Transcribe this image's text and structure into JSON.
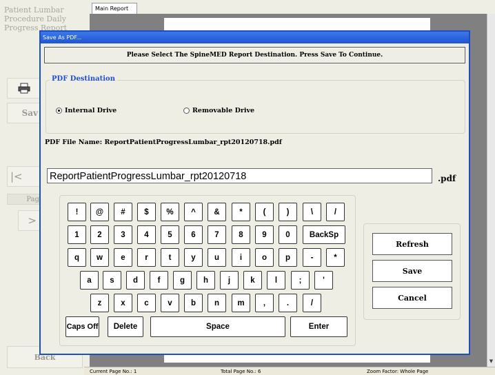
{
  "app": {
    "title": "Patient Lumbar Procedure Daily Progress Report",
    "save_label": "Sav",
    "first_label": "|<",
    "page_label": "Pag",
    "next_label": ">",
    "back_label": "Back"
  },
  "report": {
    "tab_label": "Main Report",
    "status": {
      "current_page": "Current Page No.: 1",
      "total_page": "Total Page No.: 6",
      "zoom": "Zoom Factor: Whole Page"
    }
  },
  "dialog": {
    "title": "Save As PDF...",
    "instruction": "Please Select The SpineMED Report Destination. Press Save To Continue.",
    "destination_legend": "PDF Destination",
    "options": [
      {
        "label": "Internal Drive",
        "selected": true
      },
      {
        "label": "Removable Drive",
        "selected": false
      }
    ],
    "filename_label": "PDF File Name: ReportPatientProgressLumbar_rpt20120718.pdf",
    "filename_value": "ReportPatientProgressLumbar_rpt20120718",
    "extension": ".pdf"
  },
  "keyboard": {
    "rows": [
      [
        "!",
        "@",
        "#",
        "$",
        "%",
        "^",
        "&",
        "*",
        "(",
        ")",
        "\\",
        "/"
      ],
      [
        "1",
        "2",
        "3",
        "4",
        "5",
        "6",
        "7",
        "8",
        "9",
        "0",
        "BackSp"
      ],
      [
        "q",
        "w",
        "e",
        "r",
        "t",
        "y",
        "u",
        "i",
        "o",
        "p",
        "-",
        "*"
      ],
      [
        "a",
        "s",
        "d",
        "f",
        "g",
        "h",
        "j",
        "k",
        "l",
        ";",
        "'"
      ],
      [
        "z",
        "x",
        "c",
        "v",
        "b",
        "n",
        "m",
        ",",
        ".",
        "/"
      ]
    ],
    "bottom": {
      "caps": "Caps Off",
      "delete": "Delete",
      "space": "Space",
      "enter": "Enter"
    }
  },
  "actions": {
    "refresh": "Refresh",
    "save": "Save",
    "cancel": "Cancel"
  }
}
